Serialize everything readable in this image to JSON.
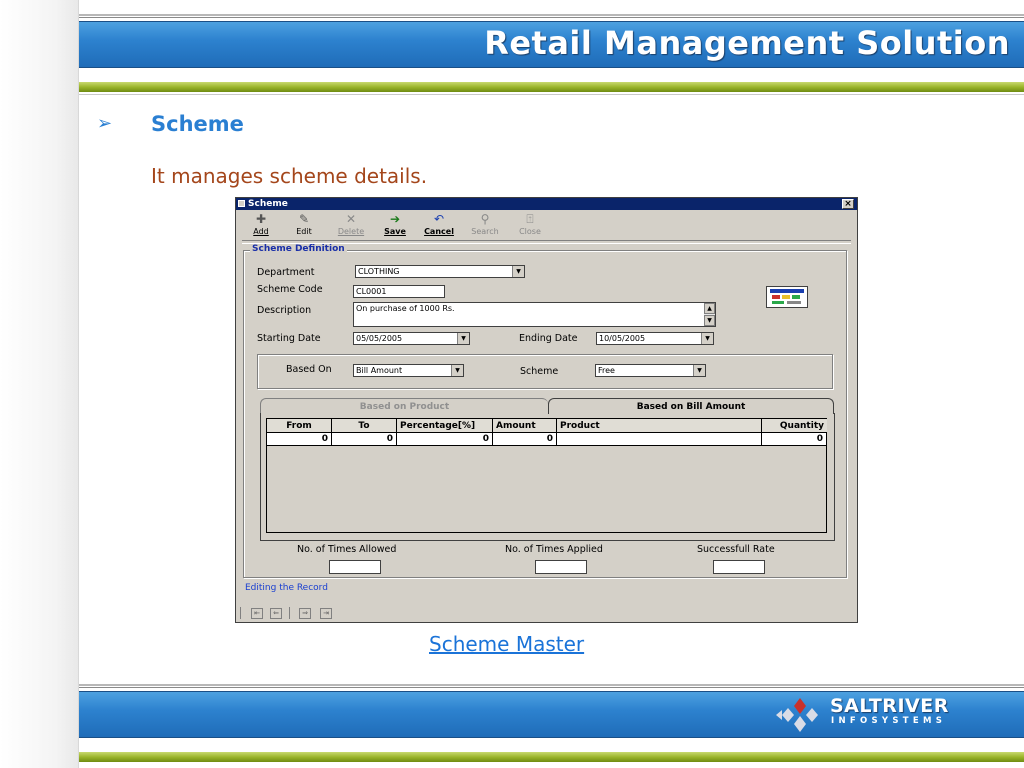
{
  "slide": {
    "header_title": "Retail Management Solution",
    "section_heading": "Scheme",
    "section_description": "It manages scheme details.",
    "caption": "Scheme Master"
  },
  "window": {
    "title": "Scheme",
    "close_glyph": "×",
    "toolbar": [
      {
        "label": "Add",
        "icon": "plus-icon",
        "enabled": true
      },
      {
        "label": "Edit",
        "icon": "pencil-icon",
        "enabled": true
      },
      {
        "label": "Delete",
        "icon": "delete-x-icon",
        "enabled": false
      },
      {
        "label": "Save",
        "icon": "save-arrow-icon",
        "enabled": true
      },
      {
        "label": "Cancel",
        "icon": "undo-icon",
        "enabled": true
      },
      {
        "label": "Search",
        "icon": "search-icon",
        "enabled": false
      },
      {
        "label": "Close",
        "icon": "door-icon",
        "enabled": false
      }
    ],
    "scheme_definition": {
      "group_title": "Scheme Definition",
      "department_label": "Department",
      "department_value": "CLOTHING",
      "scheme_code_label": "Scheme Code",
      "scheme_code_value": "CL0001",
      "description_label": "Description",
      "description_value": "On purchase of 1000 Rs.",
      "starting_date_label": "Starting Date",
      "starting_date_value": "05/05/2005",
      "ending_date_label": "Ending Date",
      "ending_date_value": "10/05/2005",
      "based_on_label": "Based On",
      "based_on_value": "Bill Amount",
      "scheme_label": "Scheme",
      "scheme_value": "Free"
    },
    "tabs": [
      {
        "label": "Based on Product",
        "active": false
      },
      {
        "label": "Based on Bill Amount",
        "active": true
      }
    ],
    "grid": {
      "columns": [
        "From",
        "To",
        "Percentage[%]",
        "Amount",
        "Product",
        "Quantity"
      ],
      "rows": [
        [
          "0",
          "0",
          "0",
          "0",
          "",
          "0"
        ]
      ]
    },
    "counts": {
      "times_allowed_label": "No. of Times Allowed",
      "times_applied_label": "No. of Times Applied",
      "success_rate_label": "Successfull Rate"
    },
    "status_text": "Editing the Record",
    "nav_buttons": [
      "first-record-icon",
      "previous-record-icon",
      "next-record-icon",
      "last-record-icon"
    ]
  },
  "logo": {
    "name": "SALTRIVER",
    "tagline": "INFOSYSTEMS"
  },
  "colors": {
    "header_blue": "#2d82cf",
    "accent_green": "#9bb52b",
    "heading_blue": "#2a7fd2",
    "description_brown": "#a4461b",
    "window_face": "#d4d0c8",
    "titlebar_navy": "#0a246a"
  }
}
